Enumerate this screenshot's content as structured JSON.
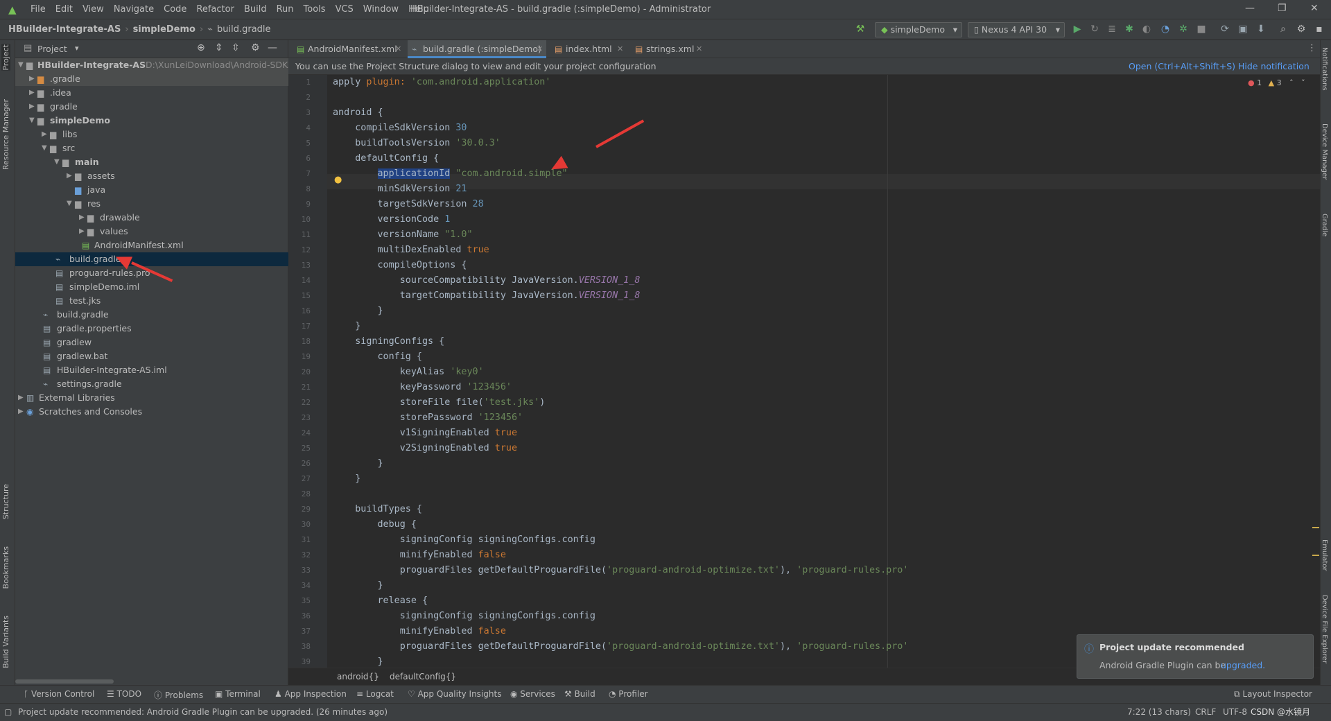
{
  "menubar": {
    "items": [
      "File",
      "Edit",
      "View",
      "Navigate",
      "Code",
      "Refactor",
      "Build",
      "Run",
      "Tools",
      "VCS",
      "Window",
      "Help"
    ],
    "window_title": "HBuilder-Integrate-AS - build.gradle (:simpleDemo) - Administrator"
  },
  "navbar": {
    "crumbs": [
      "HBuilder-Integrate-AS",
      "simpleDemo",
      "build.gradle"
    ],
    "run_config": "simpleDemo",
    "device": "Nexus 4 API 30"
  },
  "side_tools_left": [
    "Project",
    "Resource Manager",
    "Structure",
    "Bookmarks",
    "Build Variants"
  ],
  "side_tools_right": [
    "Notifications",
    "Device Manager",
    "Gradle",
    "Emulator",
    "Device File Explorer"
  ],
  "project_panel": {
    "title": "Project",
    "tree": [
      {
        "label": "HBuilder-Integrate-AS",
        "path": "D:\\XunLeiDownload\\Android-SDK@",
        "bold": true,
        "icon": "module-folder-icon"
      },
      {
        "label": ".gradle",
        "icon": "folder-orange-icon"
      },
      {
        "label": ".idea",
        "icon": "folder-icon"
      },
      {
        "label": "gradle",
        "icon": "folder-icon"
      },
      {
        "label": "simpleDemo",
        "bold": true,
        "icon": "module-folder-icon"
      },
      {
        "label": "libs",
        "icon": "folder-icon"
      },
      {
        "label": "src",
        "icon": "folder-icon"
      },
      {
        "label": "main",
        "bold": true,
        "icon": "folder-icon"
      },
      {
        "label": "assets",
        "icon": "folder-icon"
      },
      {
        "label": "java",
        "icon": "folder-icon"
      },
      {
        "label": "res",
        "icon": "folder-icon"
      },
      {
        "label": "drawable",
        "icon": "folder-icon"
      },
      {
        "label": "values",
        "icon": "folder-icon"
      },
      {
        "label": "AndroidManifest.xml",
        "icon": "manifest-icon"
      },
      {
        "label": "build.gradle",
        "icon": "gradle-icon",
        "selected": true
      },
      {
        "label": "proguard-rules.pro",
        "icon": "file-icon"
      },
      {
        "label": "simpleDemo.iml",
        "icon": "file-icon"
      },
      {
        "label": "test.jks",
        "icon": "file-icon"
      },
      {
        "label": "build.gradle",
        "icon": "gradle-icon"
      },
      {
        "label": "gradle.properties",
        "icon": "file-icon"
      },
      {
        "label": "gradlew",
        "icon": "file-icon"
      },
      {
        "label": "gradlew.bat",
        "icon": "file-icon"
      },
      {
        "label": "HBuilder-Integrate-AS.iml",
        "icon": "file-icon"
      },
      {
        "label": "settings.gradle",
        "icon": "gradle-icon"
      },
      {
        "label": "External Libraries",
        "icon": "library-icon"
      },
      {
        "label": "Scratches and Consoles",
        "icon": "scratch-icon"
      }
    ]
  },
  "editor_tabs": [
    {
      "label": "AndroidManifest.xml",
      "icon": "manifest-icon"
    },
    {
      "label": "build.gradle (:simpleDemo)",
      "icon": "gradle-icon",
      "active": true
    },
    {
      "label": "index.html",
      "icon": "html-icon"
    },
    {
      "label": "strings.xml",
      "icon": "xml-icon"
    }
  ],
  "banner": {
    "message": "You can use the Project Structure dialog to view and edit your project configuration",
    "open_link": "Open (Ctrl+Alt+Shift+S)",
    "hide_link": "Hide notification"
  },
  "inspections": {
    "errors": "1",
    "warnings": "3"
  },
  "code_lines": [
    "apply plugin: 'com.android.application'",
    "",
    "android {",
    "    compileSdkVersion 30",
    "    buildToolsVersion '30.0.3'",
    "    defaultConfig {",
    "        applicationId \"com.android.simple\"",
    "        minSdkVersion 21",
    "        targetSdkVersion 28",
    "        versionCode 1",
    "        versionName \"1.0\"",
    "        multiDexEnabled true",
    "        compileOptions {",
    "            sourceCompatibility JavaVersion.VERSION_1_8",
    "            targetCompatibility JavaVersion.VERSION_1_8",
    "        }",
    "    }",
    "    signingConfigs {",
    "        config {",
    "            keyAlias 'key0'",
    "            keyPassword '123456'",
    "            storeFile file('test.jks')",
    "            storePassword '123456'",
    "            v1SigningEnabled true",
    "            v2SigningEnabled true",
    "        }",
    "    }",
    "",
    "    buildTypes {",
    "        debug {",
    "            signingConfig signingConfigs.config",
    "            minifyEnabled false",
    "            proguardFiles getDefaultProguardFile('proguard-android-optimize.txt'), 'proguard-rules.pro'",
    "        }",
    "        release {",
    "            signingConfig signingConfigs.config",
    "            minifyEnabled false",
    "            proguardFiles getDefaultProguardFile('proguard-android-optimize.txt'), 'proguard-rules.pro'",
    "        }"
  ],
  "line_numbers": [
    "1",
    "2",
    "3",
    "4",
    "5",
    "6",
    "7",
    "8",
    "9",
    "10",
    "11",
    "12",
    "13",
    "14",
    "15",
    "16",
    "17",
    "18",
    "19",
    "20",
    "21",
    "22",
    "23",
    "24",
    "25",
    "26",
    "27",
    "28",
    "29",
    "30",
    "31",
    "32",
    "33",
    "34",
    "35",
    "36",
    "37",
    "38",
    "39"
  ],
  "editor_breadcrumb": [
    "android{}",
    "defaultConfig{}"
  ],
  "tool_windows": [
    "Version Control",
    "TODO",
    "Problems",
    "Terminal",
    "App Inspection",
    "Logcat",
    "App Quality Insights",
    "Services",
    "Build",
    "Profiler"
  ],
  "layout_inspector": "Layout Inspector",
  "notification": {
    "title": "Project update recommended",
    "body": "Android Gradle Plugin can be",
    "link": "upgraded."
  },
  "statusbar": {
    "message": "Project update recommended: Android Gradle Plugin can be upgraded. (26 minutes ago)",
    "position": "7:22 (13 chars)",
    "line_sep": "CRLF",
    "encoding": "UTF-8",
    "watermark": "CSDN @水镜月"
  },
  "colors": {
    "accent": "#4a88c7",
    "selection": "#0d293e",
    "annotation_arrow": "#e53935"
  }
}
